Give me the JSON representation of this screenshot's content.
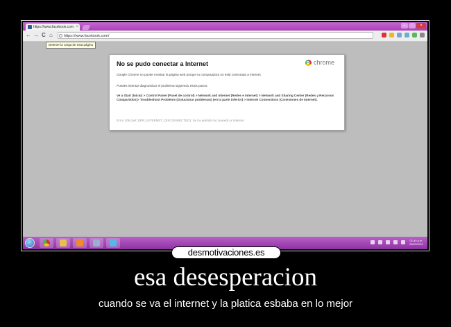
{
  "browser": {
    "tab_title": "https://www.facebook.com",
    "tab_close": "×",
    "address": "https://www.facebook.com/",
    "tooltip": "Detener la carga de esta página",
    "nav": {
      "back": "←",
      "forward": "→",
      "reload": "C",
      "home": "⌂"
    },
    "window_controls": {
      "minimize": "–",
      "maximize": "□",
      "close": "×"
    }
  },
  "error_page": {
    "heading": "No se pudo conectar a Internet",
    "brand": "chrome",
    "para1": "Google Chrome no puede mostrar la página web porque tu computadora no está conectada a Internet.",
    "para2": "Puedes intentar diagnosticar el problema siguiendo estos pasos:",
    "para3": "Ve a Start (Inicio) > Control Panel (Panel de control) > Network and Internet (Redes e Internet) > Network and Sharing Center (Redes y Recursos Compartidos)> Troubleshoot Problems (Solucionar problemas) (en la parte inferior) > Internet Connections (Conexiones de Internet).",
    "error_code": "Error 106 (net::ERR_INTERNET_DISCONNECTED): Se ha perdido la conexión a Internet."
  },
  "taskbar": {
    "clock_time": "01:44 p.m.",
    "clock_date": "28/01/2011"
  },
  "poster": {
    "logo": "desmotivaciones.es",
    "title": "esa desesperacion",
    "caption": "cuando se va el internet y la platica esbaba en lo mejor"
  },
  "colors": {
    "accent_purple": "#a942b8",
    "screen_gray": "#bdbdbd",
    "background": "#000000"
  }
}
